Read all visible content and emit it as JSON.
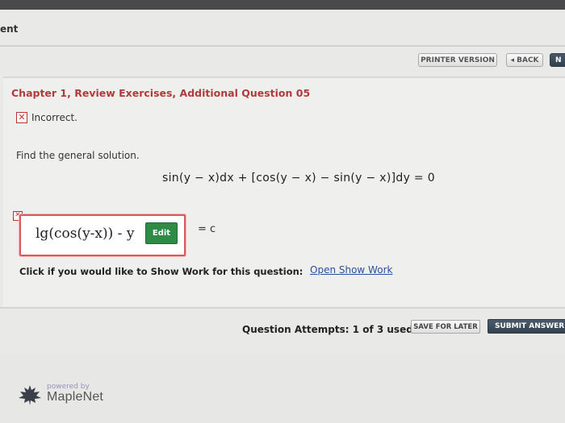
{
  "header": {
    "breadcrumb": "ent"
  },
  "toolbar": {
    "printer_version": "PRINTER VERSION",
    "back": "◂ BACK",
    "next": "N"
  },
  "question": {
    "title": "Chapter 1, Review Exercises, Additional Question 05",
    "status_text": "Incorrect.",
    "prompt": "Find the general solution.",
    "equation": "sin(y − x)dx + [cos(y − x) − sin(y − x)]dy = 0",
    "answer_expression": "lg(cos(y-x)) - y",
    "edit_label": "Edit",
    "equals_c": "= c"
  },
  "show_work": {
    "prompt": "Click if you would like to Show Work for this question:",
    "link": "Open Show Work"
  },
  "bottom": {
    "attempts": "Question Attempts: 1 of 3 used",
    "save_label": "SAVE FOR LATER",
    "submit_label": "SUBMIT ANSWER"
  },
  "footer": {
    "powered_by": "powered by",
    "brand": "MapleNet"
  },
  "colors": {
    "title_red": "#b13a3a",
    "edit_green": "#2e8b46",
    "link_blue": "#2a4fa0",
    "dark_button": "#33404d"
  }
}
